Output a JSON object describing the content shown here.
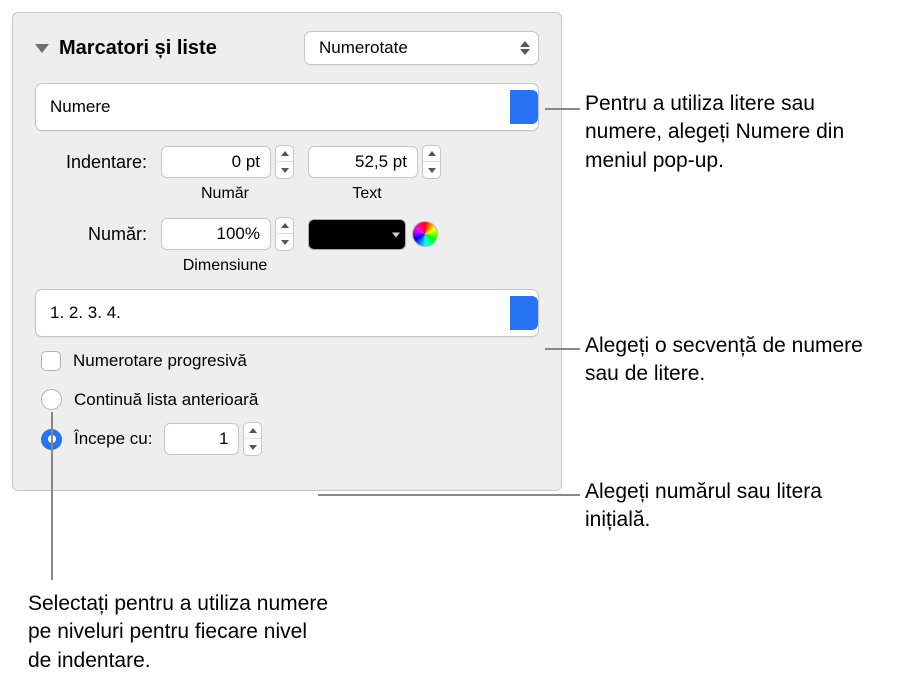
{
  "section": {
    "title": "Marcatori și liste",
    "style_popup": "Numerotate",
    "type_popup": "Numere"
  },
  "indent": {
    "label": "Indentare:",
    "number_value": "0 pt",
    "text_value": "52,5 pt",
    "number_caption": "Număr",
    "text_caption": "Text"
  },
  "number_size": {
    "label": "Număr:",
    "value": "100%",
    "caption": "Dimensiune"
  },
  "sequence": {
    "value": "1. 2. 3. 4."
  },
  "tiered": {
    "label": "Numerotare progresivă"
  },
  "continuation": {
    "continue_label": "Continuă lista anterioară",
    "start_label": "Începe cu:",
    "start_value": "1"
  },
  "callouts": {
    "type": "Pentru a utiliza litere sau numere, alegeți Numere din meniul pop-up.",
    "sequence": "Alegeți o secvență de numere sau de litere.",
    "start": "Alegeți numărul sau litera inițială.",
    "tiered": "Selectați pentru a utiliza numere pe niveluri pentru fiecare nivel de indentare."
  }
}
